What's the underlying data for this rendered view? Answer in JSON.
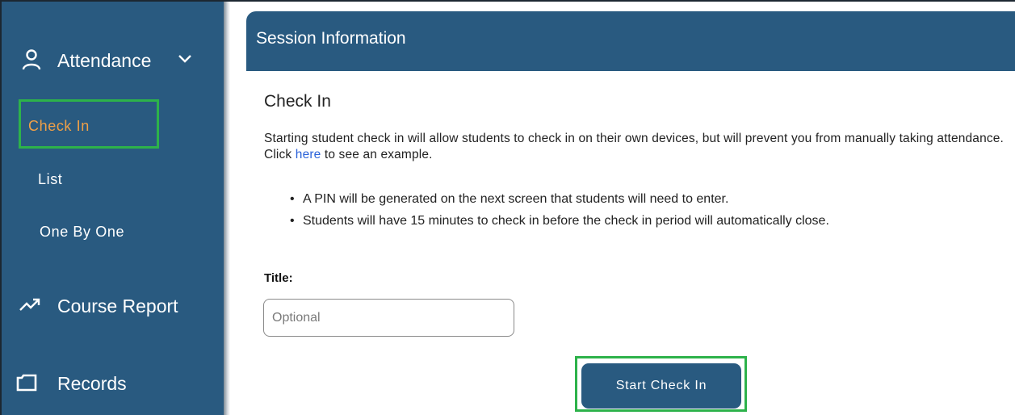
{
  "sidebar": {
    "attendance": {
      "label": "Attendance",
      "icon": "user-icon",
      "chevron": "chevron-down-icon"
    },
    "items": [
      {
        "label": "Check In",
        "active": true
      },
      {
        "label": "List",
        "active": false
      },
      {
        "label": "One By One",
        "active": false
      }
    ],
    "course_report": {
      "label": "Course Report",
      "icon": "trending-up-icon"
    },
    "records": {
      "label": "Records",
      "icon": "folder-icon"
    }
  },
  "main": {
    "header_title": "Session Information",
    "section_title": "Check In",
    "description_before_link": "Starting student check in will allow students to check in on their own devices, but will prevent you from manually taking attendance. Click ",
    "description_link": "here",
    "description_after_link": " to see an example.",
    "bullets": [
      "A PIN will be generated on the next screen that students will need to enter.",
      "Students will have 15 minutes to check in before the check in period will automatically close."
    ],
    "title_field": {
      "label": "Title:",
      "placeholder": "Optional",
      "value": ""
    },
    "start_button": "Start Check In"
  },
  "colors": {
    "brand": "#295a80",
    "active_item": "#f0a046",
    "highlight": "#2db24a",
    "link": "#2a62d9"
  }
}
